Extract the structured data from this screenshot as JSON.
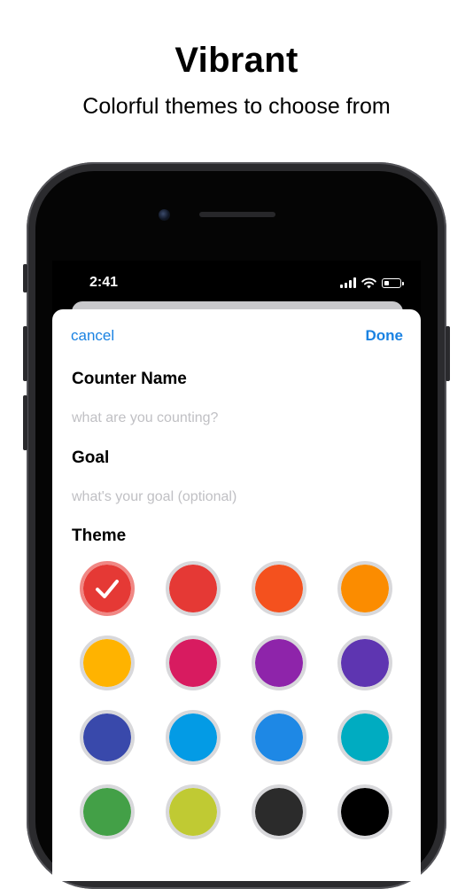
{
  "headline": "Vibrant",
  "subheadline": "Colorful themes to choose from",
  "status_bar": {
    "time": "2:41"
  },
  "nav": {
    "cancel_label": "cancel",
    "done_label": "Done"
  },
  "form": {
    "counter_name_label": "Counter Name",
    "counter_name_placeholder": "what are you counting?",
    "goal_label": "Goal",
    "goal_placeholder": "what's your goal (optional)",
    "theme_label": "Theme"
  },
  "themes": [
    {
      "name": "red-selected",
      "color": "#e53935",
      "selected": true
    },
    {
      "name": "red",
      "color": "#e53935",
      "selected": false
    },
    {
      "name": "deep-orange",
      "color": "#f4511e",
      "selected": false
    },
    {
      "name": "orange",
      "color": "#fb8c00",
      "selected": false
    },
    {
      "name": "amber",
      "color": "#ffb300",
      "selected": false
    },
    {
      "name": "pink",
      "color": "#d81b60",
      "selected": false
    },
    {
      "name": "purple",
      "color": "#8e24aa",
      "selected": false
    },
    {
      "name": "deep-purple",
      "color": "#5e35b1",
      "selected": false
    },
    {
      "name": "indigo",
      "color": "#3949ab",
      "selected": false
    },
    {
      "name": "light-blue",
      "color": "#039be5",
      "selected": false
    },
    {
      "name": "blue",
      "color": "#1e88e5",
      "selected": false
    },
    {
      "name": "cyan",
      "color": "#00acc1",
      "selected": false
    },
    {
      "name": "green",
      "color": "#43a047",
      "selected": false
    },
    {
      "name": "lime",
      "color": "#c0ca33",
      "selected": false
    },
    {
      "name": "dark-grey",
      "color": "#2b2b2b",
      "selected": false
    },
    {
      "name": "black",
      "color": "#000000",
      "selected": false
    }
  ],
  "colors": {
    "accent": "#1a82e2",
    "placeholder": "#c0c0c4"
  }
}
